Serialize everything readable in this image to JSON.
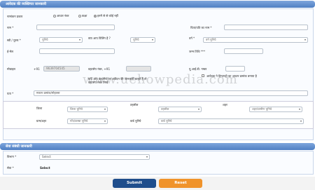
{
  "section1": {
    "title": "आवेदक की व्यक्तिगत जानकारी",
    "name_type_label": "नामांकन प्रकार",
    "radio_options": [
      "आधार नंबर",
      "कक्षा",
      "इनमें से से कोई नहीं"
    ],
    "name_label": "नाम *",
    "father_label": "पिता/पति का नाम *",
    "gender_label": "स्त्री / पुरुष *",
    "gender_value": "चुनिये",
    "dob_label": "क्या आप विलिंग है ?",
    "dob_value": "चुनिये",
    "caste_label": "वर्ग *",
    "caste_value": "वर्ग चुनिये",
    "email_label": "ई-मेल",
    "birth_label": "जन्म तिथि ***",
    "mobile_label": "मोबाइल",
    "country_code": "+91",
    "mobile_value": "9639704545",
    "alt_mobile_label": "वहटसेप नंबर,  +91",
    "alt_note": "यदि आप वहटसेप पर आवेदन की जानकारी चाहते हैं तो वहटसेप नंबर लिखे",
    "aadhar_label": "यू.आई.डी. नम्बर",
    "aadhar_check_label": "आवेदक ने हिन्दगढ़ी का आधार क्रमांक बनाया है",
    "address_label": "पता *",
    "address_placeholder": "मकान क्रमांक/मोहल्ला",
    "district_label": "जिला",
    "district_value": "जिला चुनिये",
    "tehsil_label": "तहसील",
    "tehsil_value": "तहसील",
    "ward_label": "शहर",
    "ward_value": "शहर/ग्रामीण चुनिये",
    "village_label": "ग्राम/शहर",
    "village_value": "गाँव/कस्बा चुनिये",
    "ward_no_label": "वार्ड चुनिये",
    "ward_no_value": "वार्ड चुनिये"
  },
  "section2": {
    "title": "सेवा संबंधी जानकारी",
    "dept_label": "विभाग *",
    "dept_value": "Select",
    "service_label": "सेवा *",
    "service_value": "Select"
  },
  "buttons": {
    "submit": "Submit",
    "reset": "Reset"
  },
  "watermark": "www.uehowpedia.com",
  "colors": {
    "header": "#5a87c8",
    "submit": "#1f4e8c",
    "reset": "#f0932b"
  }
}
